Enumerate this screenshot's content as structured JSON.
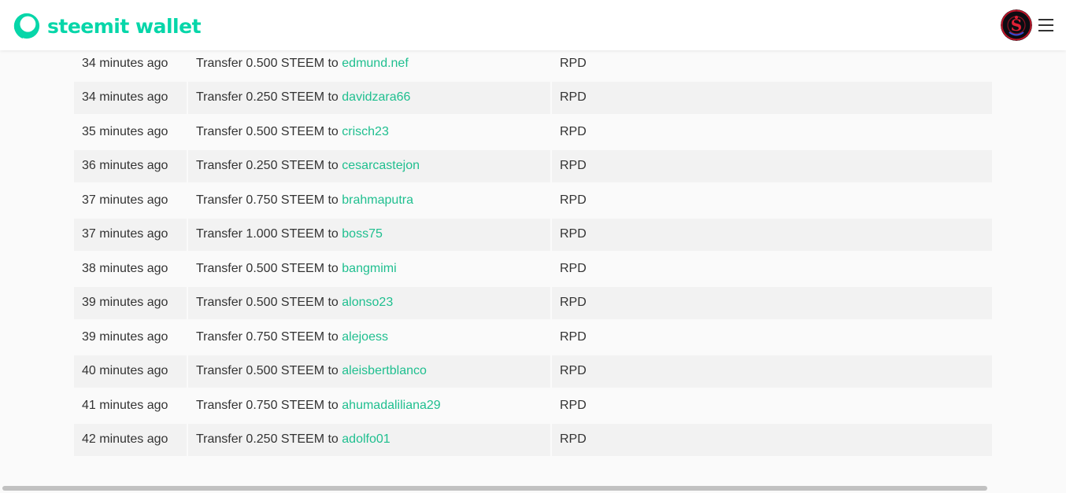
{
  "header": {
    "logo_text": "steemit wallet",
    "logo_icon": "steemit-logo-icon",
    "avatar_icon": "user-avatar",
    "menu_icon": "hamburger-menu-icon",
    "brand_color": "#06d6a9",
    "link_color": "#1fbf8f"
  },
  "transfers": [
    {
      "time": "34 minutes ago",
      "prefix": "Transfer 0.500 STEEM to ",
      "account": "edmund.nef",
      "memo": "RPD"
    },
    {
      "time": "34 minutes ago",
      "prefix": "Transfer 0.250 STEEM to ",
      "account": "davidzara66",
      "memo": "RPD"
    },
    {
      "time": "35 minutes ago",
      "prefix": "Transfer 0.500 STEEM to ",
      "account": "crisch23",
      "memo": "RPD"
    },
    {
      "time": "36 minutes ago",
      "prefix": "Transfer 0.250 STEEM to ",
      "account": "cesarcastejon",
      "memo": "RPD"
    },
    {
      "time": "37 minutes ago",
      "prefix": "Transfer 0.750 STEEM to ",
      "account": "brahmaputra",
      "memo": "RPD"
    },
    {
      "time": "37 minutes ago",
      "prefix": "Transfer 1.000 STEEM to ",
      "account": "boss75",
      "memo": "RPD"
    },
    {
      "time": "38 minutes ago",
      "prefix": "Transfer 0.500 STEEM to ",
      "account": "bangmimi",
      "memo": "RPD"
    },
    {
      "time": "39 minutes ago",
      "prefix": "Transfer 0.500 STEEM to ",
      "account": "alonso23",
      "memo": "RPD"
    },
    {
      "time": "39 minutes ago",
      "prefix": "Transfer 0.750 STEEM to ",
      "account": "alejoess",
      "memo": "RPD"
    },
    {
      "time": "40 minutes ago",
      "prefix": "Transfer 0.500 STEEM to ",
      "account": "aleisbertblanco",
      "memo": "RPD"
    },
    {
      "time": "41 minutes ago",
      "prefix": "Transfer 0.750 STEEM to ",
      "account": "ahumadaliliana29",
      "memo": "RPD"
    },
    {
      "time": "42 minutes ago",
      "prefix": "Transfer 0.250 STEEM to ",
      "account": "adolfo01",
      "memo": "RPD"
    }
  ]
}
